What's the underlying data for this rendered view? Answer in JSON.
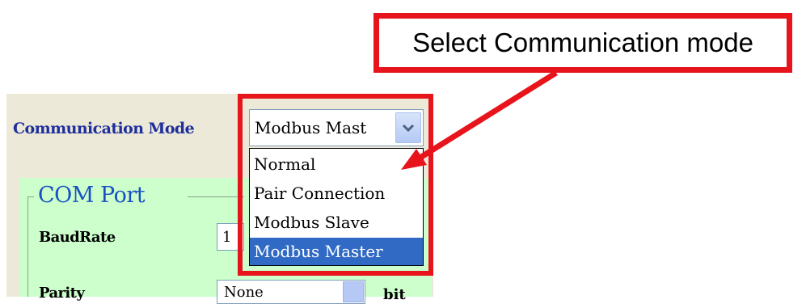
{
  "callout": {
    "text": "Select Communication mode"
  },
  "communication_mode": {
    "label": "Communication Mode",
    "selected_value": "Modbus Mast",
    "options": [
      "Normal",
      "Pair Connection",
      "Modbus Slave",
      "Modbus Master"
    ],
    "highlighted_index": 3
  },
  "com_port": {
    "title": "COM Port",
    "baudrate_label": "BaudRate",
    "baudrate_value": "1",
    "parity_label": "Parity",
    "parity_value": "None",
    "bit_label": "bit"
  },
  "colors": {
    "highlight_red": "#e8141c",
    "label_blue": "#1f2f9c",
    "group_green": "#ccffcc",
    "selection_blue": "#316ac5"
  }
}
